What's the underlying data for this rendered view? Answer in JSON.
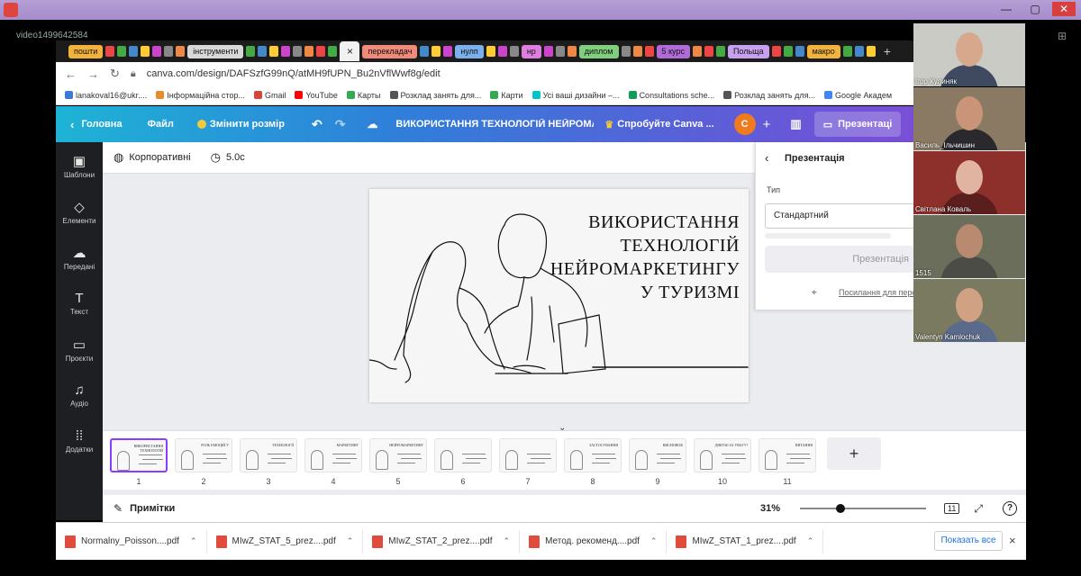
{
  "video_label": "video1499642584",
  "browser": {
    "tabs": [
      {
        "label": "пошти",
        "color": "#f2b33d"
      },
      {
        "label": "інструменти",
        "color": "#d8d8d8"
      },
      {
        "label": "перекладач",
        "color": "#f08a7a"
      },
      {
        "label": "нулп",
        "color": "#7ab0ee"
      },
      {
        "label": "нр",
        "color": "#e07de0"
      },
      {
        "label": "диплом",
        "color": "#7fcf7f"
      },
      {
        "label": "5 курс",
        "color": "#b06bd8"
      },
      {
        "label": "Польща",
        "color": "#c7a0f0"
      },
      {
        "label": "макро",
        "color": "#f2b33d"
      }
    ],
    "active_tab_icon": "×",
    "new_tab_icon": "+",
    "url": "canva.com/design/DAFSzfG99nQ/atMH9fUPN_Bu2nVflWwf8g/edit",
    "bookmarks": [
      {
        "label": "lanakoval16@ukr....",
        "color": "#3a79d8"
      },
      {
        "label": "Інформаційна стор...",
        "color": "#e88b2c"
      },
      {
        "label": "Gmail",
        "color": "#d44638"
      },
      {
        "label": "YouTube",
        "color": "#ff0000"
      },
      {
        "label": "Карты",
        "color": "#34a853"
      },
      {
        "label": "Розклад занять для...",
        "color": "#555"
      },
      {
        "label": "Карти",
        "color": "#34a853"
      },
      {
        "label": "Усі ваші дизайни –...",
        "color": "#00c4cc"
      },
      {
        "label": "Consultations sche...",
        "color": "#0f9d58"
      },
      {
        "label": "Розклад занять для...",
        "color": "#555"
      },
      {
        "label": "Google Академ",
        "color": "#4285f4"
      }
    ]
  },
  "canva": {
    "home": "Головна",
    "file": "Файл",
    "resize": "Змінити розмір",
    "doc_title": "ВИКОРИСТАННЯ ТЕХНОЛОГІЙ НЕЙРОМА...",
    "try_pro": "Спробуйте Canva ...",
    "avatar_letter": "C",
    "present": "Презентаці",
    "sidebar": [
      "Шаблони",
      "Елементи",
      "Передані",
      "Текст",
      "Проєкти",
      "Аудіо",
      "Додатки"
    ],
    "toolbar": {
      "style": "Корпоративні",
      "duration": "5.0с"
    },
    "slide_title": "ВИКОРИСТАННЯ ТЕХНОЛОГІЙ НЕЙРОМАРКЕТИНГУ У ТУРИЗМІ",
    "slide_title_lines": [
      "ВИКОРИСТАННЯ",
      "ТЕХНОЛОГІЙ",
      "НЕЙРОМАРКЕТИНГУ",
      "У ТУРИЗМІ"
    ],
    "panel": {
      "header": "Презентація",
      "type_label": "Тип",
      "type_value": "Стандартний",
      "button": "Презентація",
      "link": "Посилання для пере"
    },
    "thumbnails": [
      {
        "num": "1",
        "caption": "ВИКОРИСТАННЯ ТЕХНОЛОГІЙ"
      },
      {
        "num": "2",
        "caption": "РОЛЬ ЕМОЦІЙ У"
      },
      {
        "num": "3",
        "caption": "ТЕХНОЛОГІЇ"
      },
      {
        "num": "4",
        "caption": "МАРКЕТИНГ"
      },
      {
        "num": "5",
        "caption": "НЕЙРОМАРКЕТИНГ"
      },
      {
        "num": "6",
        "caption": ""
      },
      {
        "num": "7",
        "caption": ""
      },
      {
        "num": "8",
        "caption": "ЗАСТОСУВАННЯ"
      },
      {
        "num": "9",
        "caption": "ВИСНОВОК"
      },
      {
        "num": "10",
        "caption": "ДЯКУЮ ЗА УВАГУ!"
      },
      {
        "num": "11",
        "caption": "ПИТАННЯ"
      }
    ],
    "add_page": "+",
    "notes": "Примітки",
    "zoom": "31%",
    "page_count": "11",
    "zoom_level": 0.31
  },
  "downloads": {
    "files": [
      "Normalny_Poisson....pdf",
      "MIwZ_STAT_5_prez....pdf",
      "MIwZ_STAT_2_prez....pdf",
      "Метод. рекоменд....pdf",
      "MIwZ_STAT_1_prez....pdf"
    ],
    "show_all": "Показать все",
    "close": "×"
  },
  "participants": [
    {
      "name": "Ігор Кулиняк",
      "bg": "#c9cbc4",
      "skin": "#d7a88c",
      "shirt": "#3f4a60"
    },
    {
      "name": "Василь_Ільчишин",
      "bg": "#8b7a63",
      "skin": "#c99478",
      "shirt": "#2a2a2e"
    },
    {
      "name": "Світлана Коваль",
      "bg": "#8d2f2a",
      "skin": "#e0b4a0",
      "shirt": "#5a1e1c"
    },
    {
      "name": "1515",
      "bg": "#6b6e5a",
      "skin": "#b98a70",
      "shirt": "#4a4c45"
    },
    {
      "name": "Valentyn Kamlochuk",
      "bg": "#7a7a60",
      "skin": "#d0a283",
      "shirt": "#5a6a8a"
    }
  ]
}
